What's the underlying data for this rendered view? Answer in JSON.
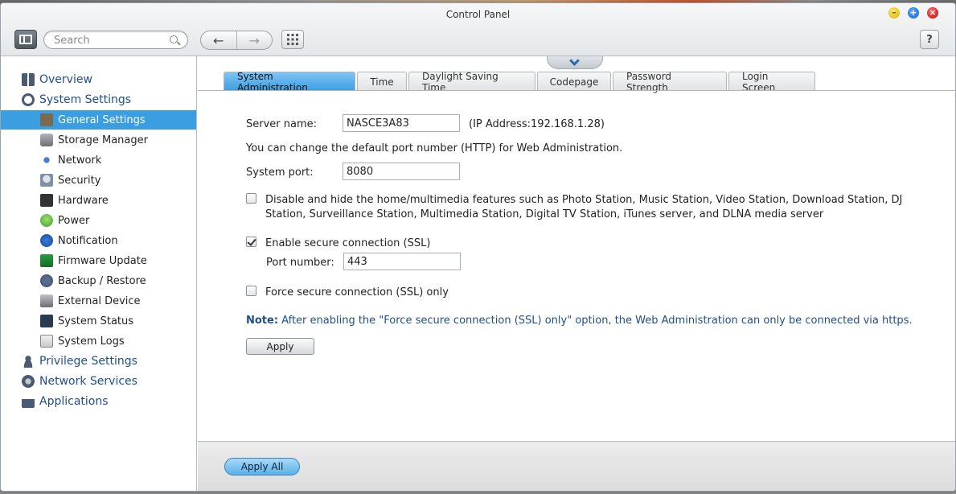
{
  "window": {
    "title": "Control Panel"
  },
  "toolbar": {
    "search_placeholder": "Search",
    "back_icon": "←",
    "forward_icon": "→",
    "apps_icon": "apps-grid-icon",
    "help_label": "?"
  },
  "sidebar": {
    "overview": "Overview",
    "system_settings": "System Settings",
    "items": [
      "General Settings",
      "Storage Manager",
      "Network",
      "Security",
      "Hardware",
      "Power",
      "Notification",
      "Firmware Update",
      "Backup / Restore",
      "External Device",
      "System Status",
      "System Logs"
    ],
    "privilege_settings": "Privilege Settings",
    "network_services": "Network Services",
    "applications": "Applications"
  },
  "tabs": [
    "System Administration",
    "Time",
    "Daylight Saving Time",
    "Codepage",
    "Password Strength",
    "Login Screen"
  ],
  "form": {
    "server_name_label": "Server name:",
    "server_name_value": "NASCE3A83",
    "ip_address_text": "(IP Address:192.168.1.28)",
    "port_info": "You can change the default port number (HTTP) for Web Administration.",
    "system_port_label": "System port:",
    "system_port_value": "8080",
    "disable_multimedia_line1": "Disable and hide the home/multimedia features such as Photo Station, Music Station, Video Station, Download Station, DJ",
    "disable_multimedia_line2": "Station, Surveillance Station, Multimedia Station, Digital TV Station, iTunes server, and DLNA media server",
    "disable_multimedia_checked": false,
    "ssl_label": "Enable secure connection (SSL)",
    "ssl_checked": true,
    "port_number_label": "Port number:",
    "port_number_value": "443",
    "force_ssl_label": "Force secure connection (SSL) only",
    "force_ssl_checked": false,
    "note_prefix": "Note:",
    "note_text": " After enabling the \"Force secure connection (SSL) only\" option, the Web Administration can only be connected via https.",
    "apply_label": "Apply"
  },
  "footer": {
    "apply_all_label": "Apply All"
  }
}
